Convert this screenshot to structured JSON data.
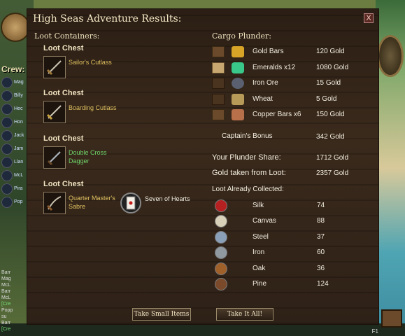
{
  "window": {
    "title": "High Seas Adventure Results:",
    "close_label": "X"
  },
  "hud": {
    "crew_label": "Crew:",
    "crew": [
      "Mag",
      "Billy",
      "Hec",
      "Hon",
      "Jack",
      "Jam",
      "Llan",
      "McL",
      "Pira",
      "Pop"
    ],
    "chat_lines": [
      {
        "text": "Barr",
        "color": "white"
      },
      {
        "text": "Mag",
        "color": "white"
      },
      {
        "text": "McL",
        "color": "white"
      },
      {
        "text": "Barr",
        "color": "white"
      },
      {
        "text": "McL",
        "color": "white"
      },
      {
        "text": "[Cre",
        "color": "green"
      },
      {
        "text": "Popp",
        "color": "white"
      },
      {
        "text": "su",
        "color": "white"
      },
      {
        "text": "Barr",
        "color": "white"
      },
      {
        "text": "[Cre",
        "color": "green"
      }
    ],
    "bottom_hint": "F1"
  },
  "loot_containers": {
    "title": "Loot Containers:",
    "chests": [
      {
        "title": "Loot Chest",
        "items": [
          {
            "name": "Sailor's Cutlass",
            "color": "yellow",
            "icon": "cutlass-icon"
          }
        ]
      },
      {
        "title": "Loot Chest",
        "items": [
          {
            "name": "Boarding Cutlass",
            "color": "yellow",
            "icon": "cutlass-icon"
          }
        ]
      },
      {
        "title": "Loot Chest",
        "items": [
          {
            "name": "Double Cross Dagger",
            "color": "green",
            "icon": "dagger-icon"
          }
        ]
      },
      {
        "title": "Loot Chest",
        "items": [
          {
            "name": "Quarter Master's Sabre",
            "color": "yellow",
            "icon": "sabre-icon"
          },
          {
            "name": "Seven of Hearts",
            "color": "white",
            "icon": "playing-card-icon"
          }
        ]
      }
    ]
  },
  "cargo": {
    "title": "Cargo Plunder:",
    "rows": [
      {
        "name": "Gold Bars",
        "value": "120 Gold",
        "icon": "gold-bars-icon"
      },
      {
        "name": "Emeralds x12",
        "value": "1080 Gold",
        "icon": "emerald-icon"
      },
      {
        "name": "Iron Ore",
        "value": "15 Gold",
        "icon": "iron-ore-icon"
      },
      {
        "name": "Wheat",
        "value": "5 Gold",
        "icon": "wheat-icon"
      },
      {
        "name": "Copper Bars x6",
        "value": "150 Gold",
        "icon": "copper-bars-icon"
      }
    ],
    "bonus_label": "Captain's Bonus",
    "bonus_value": "342 Gold"
  },
  "summary": {
    "share_label": "Your Plunder Share:",
    "share_value": "1712 Gold",
    "taken_label": "Gold taken from Loot:",
    "taken_value": "2357 Gold"
  },
  "loot_collected": {
    "title": "Loot Already Collected:",
    "rows": [
      {
        "name": "Silk",
        "value": "74",
        "icon": "silk-icon",
        "color": "#b52020"
      },
      {
        "name": "Canvas",
        "value": "88",
        "icon": "canvas-icon",
        "color": "#d8d0b8"
      },
      {
        "name": "Steel",
        "value": "37",
        "icon": "steel-icon",
        "color": "#8aa0b8"
      },
      {
        "name": "Iron",
        "value": "60",
        "icon": "iron-icon",
        "color": "#9098a0"
      },
      {
        "name": "Oak",
        "value": "36",
        "icon": "oak-icon",
        "color": "#a0602a"
      },
      {
        "name": "Pine",
        "value": "124",
        "icon": "pine-icon",
        "color": "#7a4a2a"
      }
    ]
  },
  "buttons": {
    "take_small": "Take Small Items",
    "take_all": "Take It All!"
  }
}
